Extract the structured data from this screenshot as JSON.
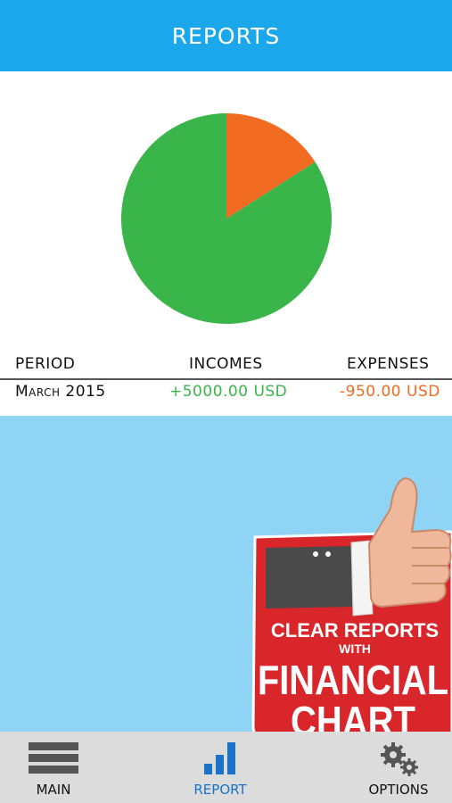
{
  "header": {
    "title": "REPORTS"
  },
  "chart_data": {
    "type": "pie",
    "slices": [
      {
        "label": "INCOMES",
        "value": 5000.0,
        "color": "#3ab54a"
      },
      {
        "label": "EXPENSES",
        "value": 950.0,
        "color": "#f16b22"
      }
    ]
  },
  "table": {
    "headers": {
      "period": "PERIOD",
      "incomes": "INCOMES",
      "expenses": "EXPENSES"
    },
    "row": {
      "period": "March 2015",
      "incomes": "+5000.00 USD",
      "expenses": "-950.00 USD"
    },
    "colors": {
      "income": "#3ab54a",
      "expense": "#f16b22"
    }
  },
  "promo": {
    "line1": "CLEAR REPORTS",
    "line2": "WITH",
    "line3": "FINANCIAL",
    "line4": "CHART"
  },
  "nav": {
    "items": [
      {
        "label": "MAIN",
        "icon": "menu-icon"
      },
      {
        "label": "REPORT",
        "icon": "bar-chart-icon",
        "active": true
      },
      {
        "label": "OPTIONS",
        "icon": "gears-icon"
      }
    ]
  },
  "colors": {
    "header": "#1aa7ec",
    "blue_area": "#8fd3f5",
    "nav_bg": "#dcdcdc",
    "active_nav": "#1a73c8"
  }
}
